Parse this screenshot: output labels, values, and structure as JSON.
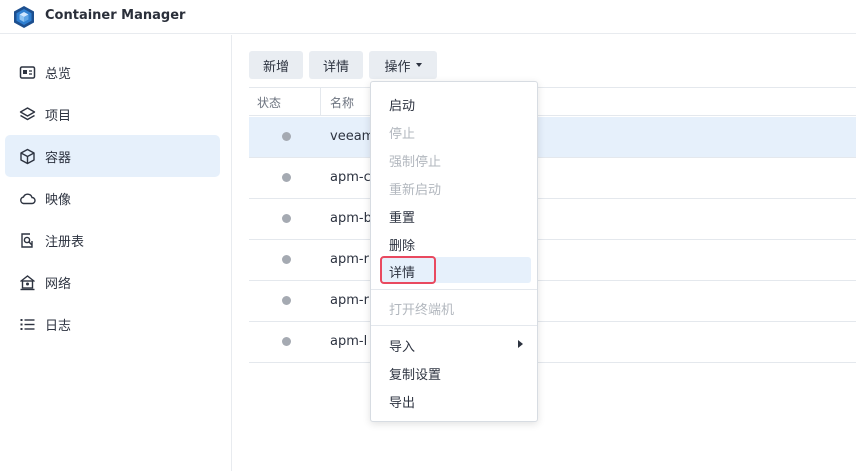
{
  "app": {
    "title": "Container Manager"
  },
  "sidebar": {
    "items": [
      {
        "label": "总览",
        "icon": "overview-icon",
        "active": false
      },
      {
        "label": "项目",
        "icon": "layers-icon",
        "active": false
      },
      {
        "label": "容器",
        "icon": "cube-icon",
        "active": true
      },
      {
        "label": "映像",
        "icon": "cloud-icon",
        "active": false
      },
      {
        "label": "注册表",
        "icon": "registry-search-icon",
        "active": false
      },
      {
        "label": "网络",
        "icon": "home-network-icon",
        "active": false
      },
      {
        "label": "日志",
        "icon": "list-icon",
        "active": false
      }
    ]
  },
  "toolbar": {
    "add_label": "新增",
    "details_label": "详情",
    "action_label": "操作"
  },
  "table": {
    "columns": [
      "状态",
      "名称"
    ],
    "rows": [
      {
        "name": "veeam",
        "status": "stopped",
        "selected": true
      },
      {
        "name": "apm-c",
        "status": "stopped",
        "selected": false
      },
      {
        "name": "apm-b",
        "status": "stopped",
        "selected": false
      },
      {
        "name": "apm-r",
        "status": "stopped",
        "selected": false
      },
      {
        "name": "apm-r",
        "status": "stopped",
        "selected": false
      },
      {
        "name": "apm-l",
        "status": "stopped",
        "selected": false
      }
    ]
  },
  "action_menu": {
    "items": [
      {
        "label": "启动",
        "disabled": false
      },
      {
        "label": "停止",
        "disabled": true
      },
      {
        "label": "强制停止",
        "disabled": true
      },
      {
        "label": "重新启动",
        "disabled": true
      },
      {
        "label": "重置",
        "disabled": false
      },
      {
        "label": "删除",
        "disabled": false
      },
      {
        "label": "详情",
        "disabled": false,
        "highlighted": true
      },
      {
        "label": "打开终端机",
        "disabled": true
      },
      {
        "label": "导入",
        "disabled": false,
        "has_submenu": true
      },
      {
        "label": "复制设置",
        "disabled": false
      },
      {
        "label": "导出",
        "disabled": false
      }
    ]
  },
  "colors": {
    "accent_bg": "#e6f0fb",
    "highlight_border": "#e9495f",
    "status_stopped": "#a5aab2"
  }
}
